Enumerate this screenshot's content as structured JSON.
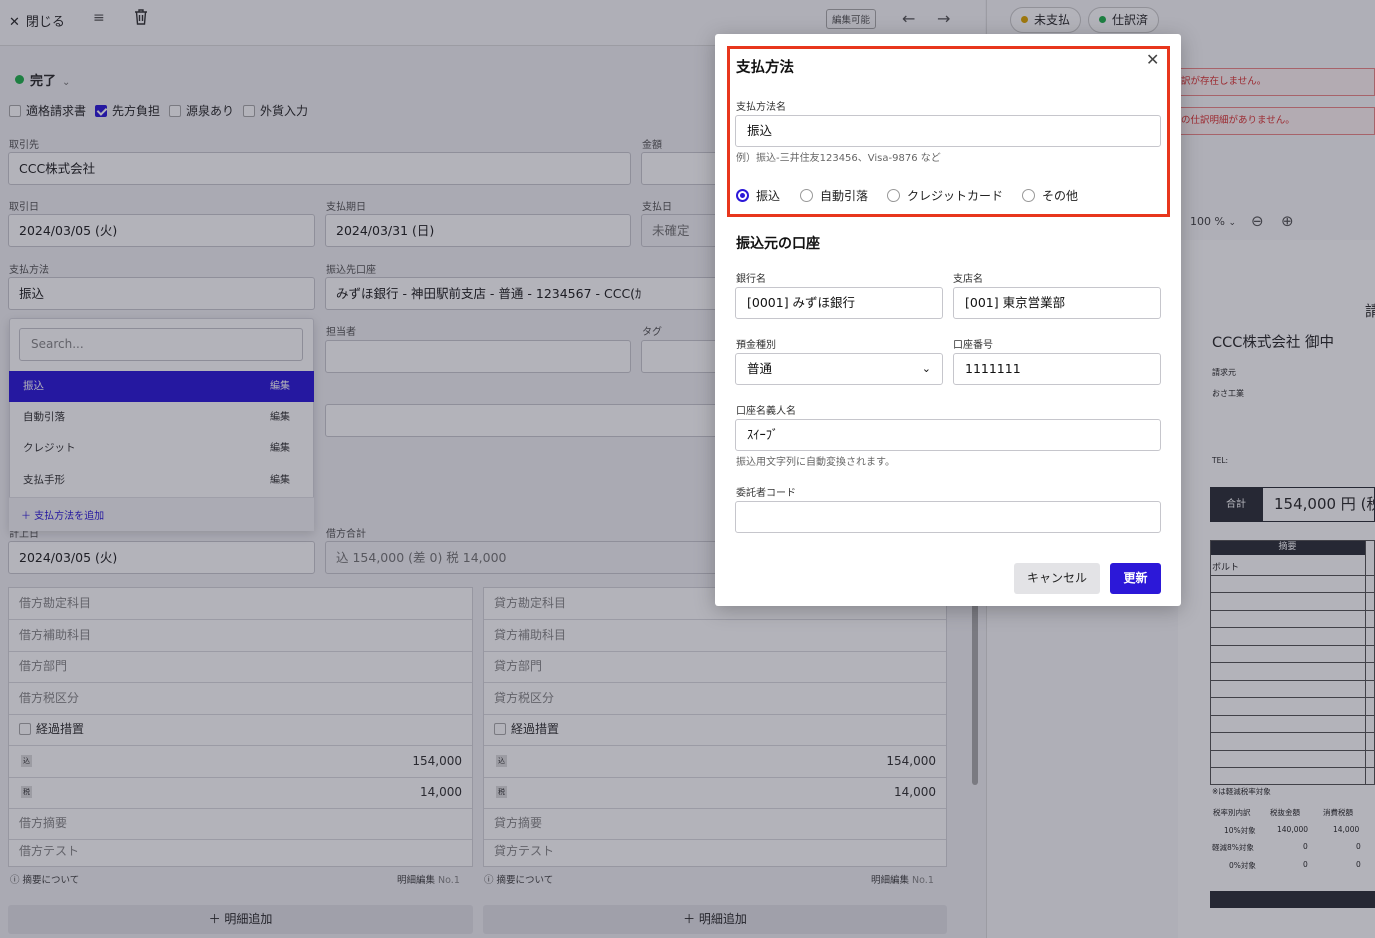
{
  "toolbar": {
    "close_label": "閉じる",
    "editable_badge": "編集可能"
  },
  "status": {
    "label": "完了"
  },
  "right_pills": {
    "unpaid": "未支払",
    "journaled": "仕訳済"
  },
  "checkboxes": [
    {
      "label": "適格請求書",
      "checked": false
    },
    {
      "label": "先方負担",
      "checked": true
    },
    {
      "label": "源泉あり",
      "checked": false
    },
    {
      "label": "外貨入力",
      "checked": false
    }
  ],
  "form": {
    "partner_label": "取引先",
    "partner_value": "CCC株式会社",
    "amount_label": "金額",
    "txn_date_label": "取引日",
    "txn_date_value": "2024/03/05 (火)",
    "due_date_label": "支払期日",
    "due_date_value": "2024/03/31 (日)",
    "pay_date_label": "支払日",
    "pay_date_value": "未確定",
    "method_label": "支払方法",
    "method_value": "振込",
    "dest_label": "振込先口座",
    "dest_value": "みずほ銀行 - 神田駅前支店 - 普通 - 1234567 - CCC(ｶ",
    "owner_label": "担当者",
    "tag_label": "タグ",
    "debit_total_label": "借方合計",
    "journal_date_label": "計上日",
    "journal_date_value": "2024/03/05 (火)",
    "debit_total_value": "込 154,000 (差 0)  税 14,000"
  },
  "dropdown": {
    "search_placeholder": "Search...",
    "items": [
      {
        "label": "振込",
        "edit": "編集"
      },
      {
        "label": "自動引落",
        "edit": "編集"
      },
      {
        "label": "クレジット",
        "edit": "編集"
      },
      {
        "label": "支払手形",
        "edit": "編集"
      }
    ],
    "add_label": "＋ 支払方法を追加"
  },
  "debit": {
    "rows": [
      "借方勘定科目",
      "借方補助科目",
      "借方部門",
      "借方税区分"
    ],
    "transition": "経過措置",
    "incl_mark": "込",
    "incl_value": "154,000",
    "tax_mark": "税",
    "tax_value": "14,000",
    "memo": "借方摘要",
    "test": "借方テスト"
  },
  "credit": {
    "rows": [
      "貸方勘定科目",
      "貸方補助科目",
      "貸方部門",
      "貸方税区分"
    ],
    "transition": "経過措置",
    "incl_mark": "込",
    "incl_value": "154,000",
    "tax_mark": "税",
    "tax_value": "14,000",
    "memo": "貸方摘要",
    "test": "貸方テスト"
  },
  "footer": {
    "about_memo": "摘要について",
    "detail_edit": "明細編集",
    "no": "No.1",
    "add_detail": "＋ 明細追加"
  },
  "right_panel": {
    "error1": "訳が存在しません。",
    "error2": "の仕訳明細がありません。",
    "zoom": "100 %",
    "doc_title_char": "請",
    "doc_partner": "CCC株式会社 御中",
    "doc_requester_label": "請求元",
    "doc_requester": "おさ工業",
    "doc_tel": "TEL:",
    "doc_total_label": "合計",
    "doc_total_value": "154,000 円 (税",
    "doc_col_memo": "摘要",
    "doc_first_item": "ボルト",
    "doc_note": "※は軽減税率対象",
    "tax_headers": [
      "税率別内訳",
      "税抜金額",
      "消費税額"
    ],
    "tax_rows": [
      [
        "10%対象",
        "140,000",
        "14,000"
      ],
      [
        "軽減8%対象",
        "0",
        "0"
      ],
      [
        "0%対象",
        "0",
        "0"
      ]
    ]
  },
  "modal": {
    "title": "支払方法",
    "name_label": "支払方法名",
    "name_value": "振込",
    "name_hint": "例）振込-三井住友123456、Visa-9876 など",
    "radios": [
      {
        "label": "振込",
        "selected": true
      },
      {
        "label": "自動引落",
        "selected": false
      },
      {
        "label": "クレジットカード",
        "selected": false
      },
      {
        "label": "その他",
        "selected": false
      }
    ],
    "section_title": "振込元の口座",
    "bank_label": "銀行名",
    "bank_value": "[0001] みずほ銀行",
    "branch_label": "支店名",
    "branch_value": "[001] 東京営業部",
    "type_label": "預金種別",
    "type_value": "普通",
    "acct_label": "口座番号",
    "acct_value": "1111111",
    "holder_label": "口座名義人名",
    "holder_value": "ｽｲｰﾌﾞ",
    "holder_hint": "振込用文字列に自動変換されます。",
    "consignor_label": "委託者コード",
    "consignor_value": "",
    "cancel_label": "キャンセル",
    "update_label": "更新",
    "accent_color": "#2c18d8",
    "highlight_color": "#e8361c"
  }
}
